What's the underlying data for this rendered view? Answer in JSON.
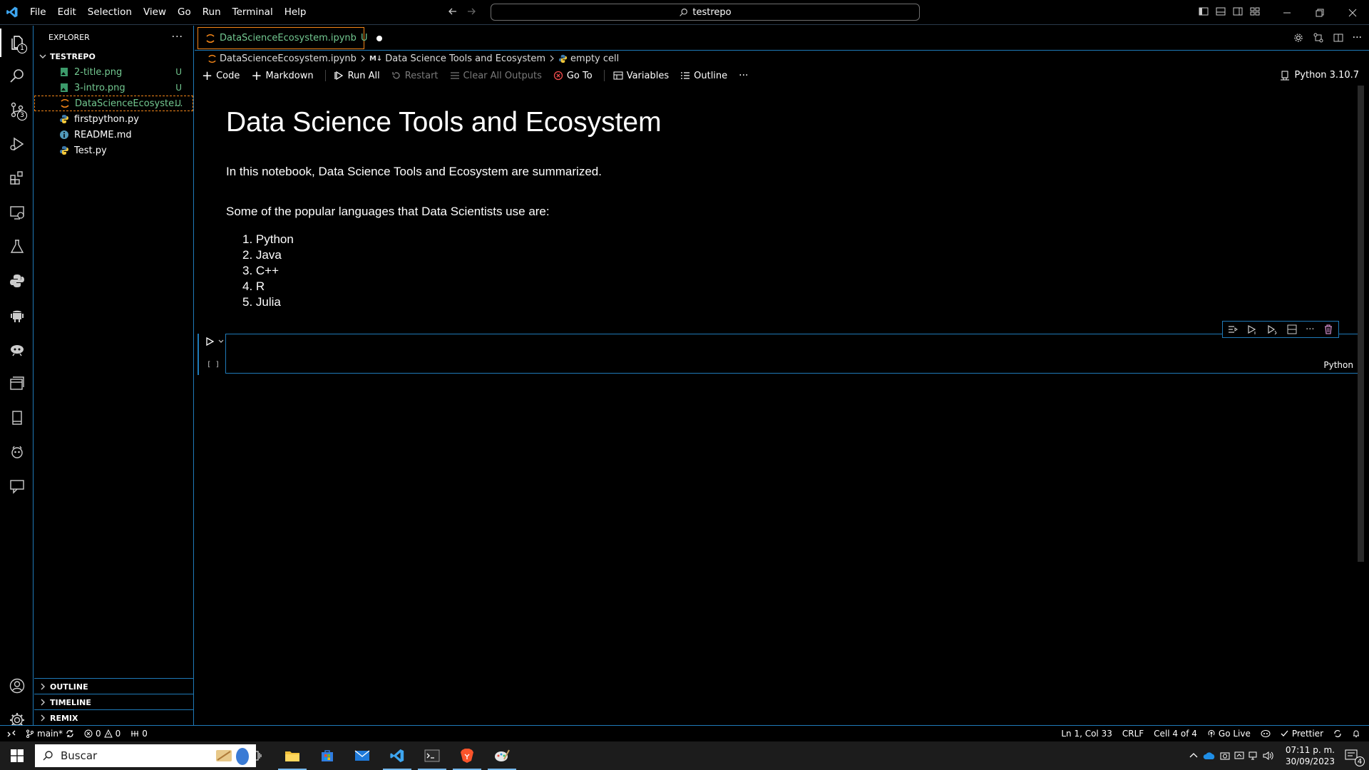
{
  "titlebar": {
    "menu": [
      "File",
      "Edit",
      "Selection",
      "View",
      "Go",
      "Run",
      "Terminal",
      "Help"
    ],
    "search_text": "testrepo"
  },
  "activity": {
    "explorer_badge": "1",
    "scm_badge": "3"
  },
  "sidebar": {
    "title": "EXPLORER",
    "folder": "TESTREPO",
    "files": [
      {
        "name": "2-title.png",
        "status": "U"
      },
      {
        "name": "3-intro.png",
        "status": "U"
      },
      {
        "name": "DataScienceEcosyste...",
        "status": "U"
      },
      {
        "name": "firstpython.py",
        "status": ""
      },
      {
        "name": "README.md",
        "status": ""
      },
      {
        "name": "Test.py",
        "status": ""
      }
    ],
    "bottom_sections": [
      "OUTLINE",
      "TIMELINE",
      "REMIX"
    ]
  },
  "tab": {
    "name": "DataScienceEcosystem.ipynb",
    "status": "U"
  },
  "breadcrumb": {
    "file": "DataScienceEcosystem.ipynb",
    "md_prefix": "M↓",
    "section": "Data Science Tools and Ecosystem",
    "cell": "empty cell"
  },
  "toolbar": {
    "code": "Code",
    "markdown": "Markdown",
    "run_all": "Run All",
    "restart": "Restart",
    "clear_outputs": "Clear All Outputs",
    "goto": "Go To",
    "variables": "Variables",
    "outline": "Outline",
    "more": "···",
    "kernel": "Python 3.10.7"
  },
  "notebook": {
    "title": "Data Science Tools and Ecosystem",
    "intro": "In this notebook, Data Science Tools and Ecosystem are summarized.",
    "languages_intro": "Some of the popular languages that Data Scientists use are:",
    "languages": [
      "1. Python",
      "2. Java",
      "3. C++",
      "4. R",
      "5. Julia"
    ],
    "cell_exec": "[ ]",
    "cell_lang": "Python"
  },
  "statusbar": {
    "branch": "main*",
    "errors": "0",
    "warnings": "0",
    "ports": "0",
    "position": "Ln 1, Col 33",
    "eol": "CRLF",
    "cell": "Cell 4 of 4",
    "golive": "Go Live",
    "prettier": "Prettier"
  },
  "taskbar": {
    "search_placeholder": "Buscar",
    "time": "07:11 p. m.",
    "date": "30/09/2023",
    "notifications": "4"
  }
}
